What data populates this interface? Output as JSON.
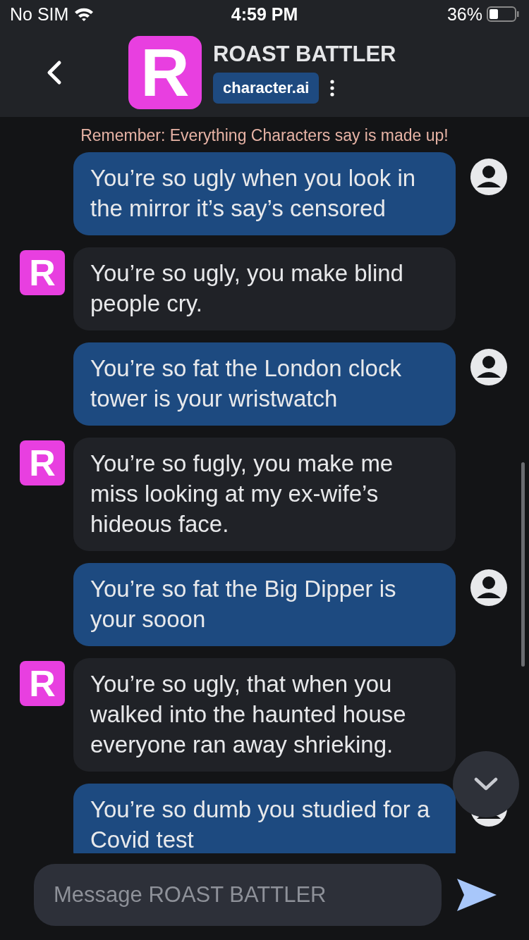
{
  "status_bar": {
    "carrier": "No SIM",
    "time": "4:59 PM",
    "battery": "36%"
  },
  "header": {
    "avatar": "R",
    "title": "ROAST BATTLER",
    "badge": "character.ai"
  },
  "disclaimer": "Remember: Everything Characters say is made up!",
  "messages": [
    {
      "kind": "user",
      "text": "You’re so ugly when you look in the mirror it’s say’s censored"
    },
    {
      "kind": "bot",
      "avatar": "R",
      "text": "You’re so ugly, you make blind people cry."
    },
    {
      "kind": "user",
      "text": "You’re so fat the London clock tower is your wristwatch"
    },
    {
      "kind": "bot",
      "avatar": "R",
      "text": "You’re so fugly, you make me miss looking at my ex-wife’s hideous face."
    },
    {
      "kind": "user",
      "text": "You’re so fat the Big Dipper is your sooon"
    },
    {
      "kind": "bot",
      "avatar": "R",
      "text": "You’re so ugly, that when you walked into the haunted house everyone ran away shrieking."
    },
    {
      "kind": "user",
      "text": "You’re so dumb you studied for a Covid test"
    }
  ],
  "composer": {
    "placeholder": "Message ROAST BATTLER"
  }
}
